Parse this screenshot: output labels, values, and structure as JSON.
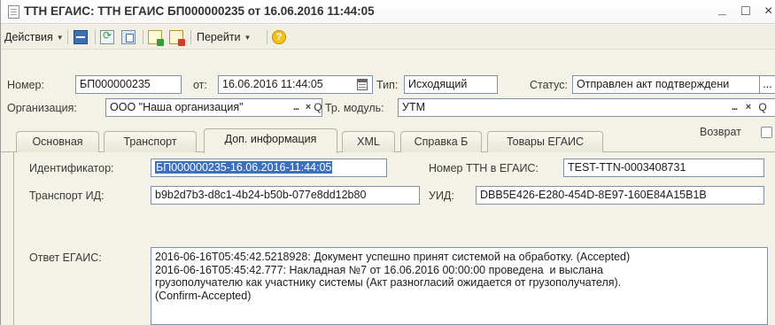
{
  "window": {
    "title": "ТТН ЕГАИС: ТТН ЕГАИС БП000000235 от 16.06.2016 11:44:05",
    "controls": {
      "minimize": "_",
      "maximize": "□",
      "close": "×"
    }
  },
  "toolbar": {
    "actions_label": "Действия",
    "goto_label": "Перейти",
    "help_glyph": "?",
    "icons": [
      "split-icon",
      "refresh-icon",
      "copy-icon",
      "document-green-icon",
      "document-red-icon",
      "help-icon"
    ]
  },
  "header": {
    "number_label": "Номер:",
    "number_value": "БП000000235",
    "date_label": "от:",
    "date_value": "16.06.2016 11:44:05",
    "type_label": "Тип:",
    "type_value": "Исходящий",
    "status_label": "Статус:",
    "status_value": "Отправлен акт подтверждени",
    "org_label": "Организация:",
    "org_value": "ООО \"Наша организация\"",
    "module_label": "Тр. модуль:",
    "module_value": "УТМ",
    "dots_glyph": "...",
    "clear_glyph": "×",
    "search_glyph": "Q"
  },
  "tabs": [
    {
      "label": "Основная",
      "active": false
    },
    {
      "label": "Транспорт",
      "active": false
    },
    {
      "label": "Доп. информация",
      "active": true
    },
    {
      "label": "XML",
      "active": false
    },
    {
      "label": "Справка Б",
      "active": false
    },
    {
      "label": "Товары ЕГАИС",
      "active": false
    }
  ],
  "return_label": "Возврат",
  "return_checked": false,
  "extra": {
    "identifier_label": "Идентификатор:",
    "identifier_value": "БП000000235-16.06.2016-11:44:05",
    "ttn_number_label": "Номер ТТН в ЕГАИС:",
    "ttn_number_value": "TEST-TTN-0003408731",
    "transport_id_label": "Транспорт ИД:",
    "transport_id_value": "b9b2d7b3-d8c1-4b24-b50b-077e8dd12b80",
    "uid_label": "УИД:",
    "uid_value": "DBB5E426-E280-454D-8E97-160E84A15B1B",
    "response_label": "Ответ ЕГАИС:",
    "response_value": "2016-06-16T05:45:42.5218928: Документ успешно принят системой на обработку. (Accepted)\n2016-06-16T05:45:42.777: Накладная №7 от 16.06.2016 00:00:00 проведена  и выслана\nгрузополучателю как участнику системы (Акт разногласий ожидается от грузополучателя).\n(Confirm-Accepted)"
  },
  "colors": {
    "background": "#f4f2e6",
    "field_border": "#7e8fa6",
    "selection": "#3d6fc0"
  }
}
